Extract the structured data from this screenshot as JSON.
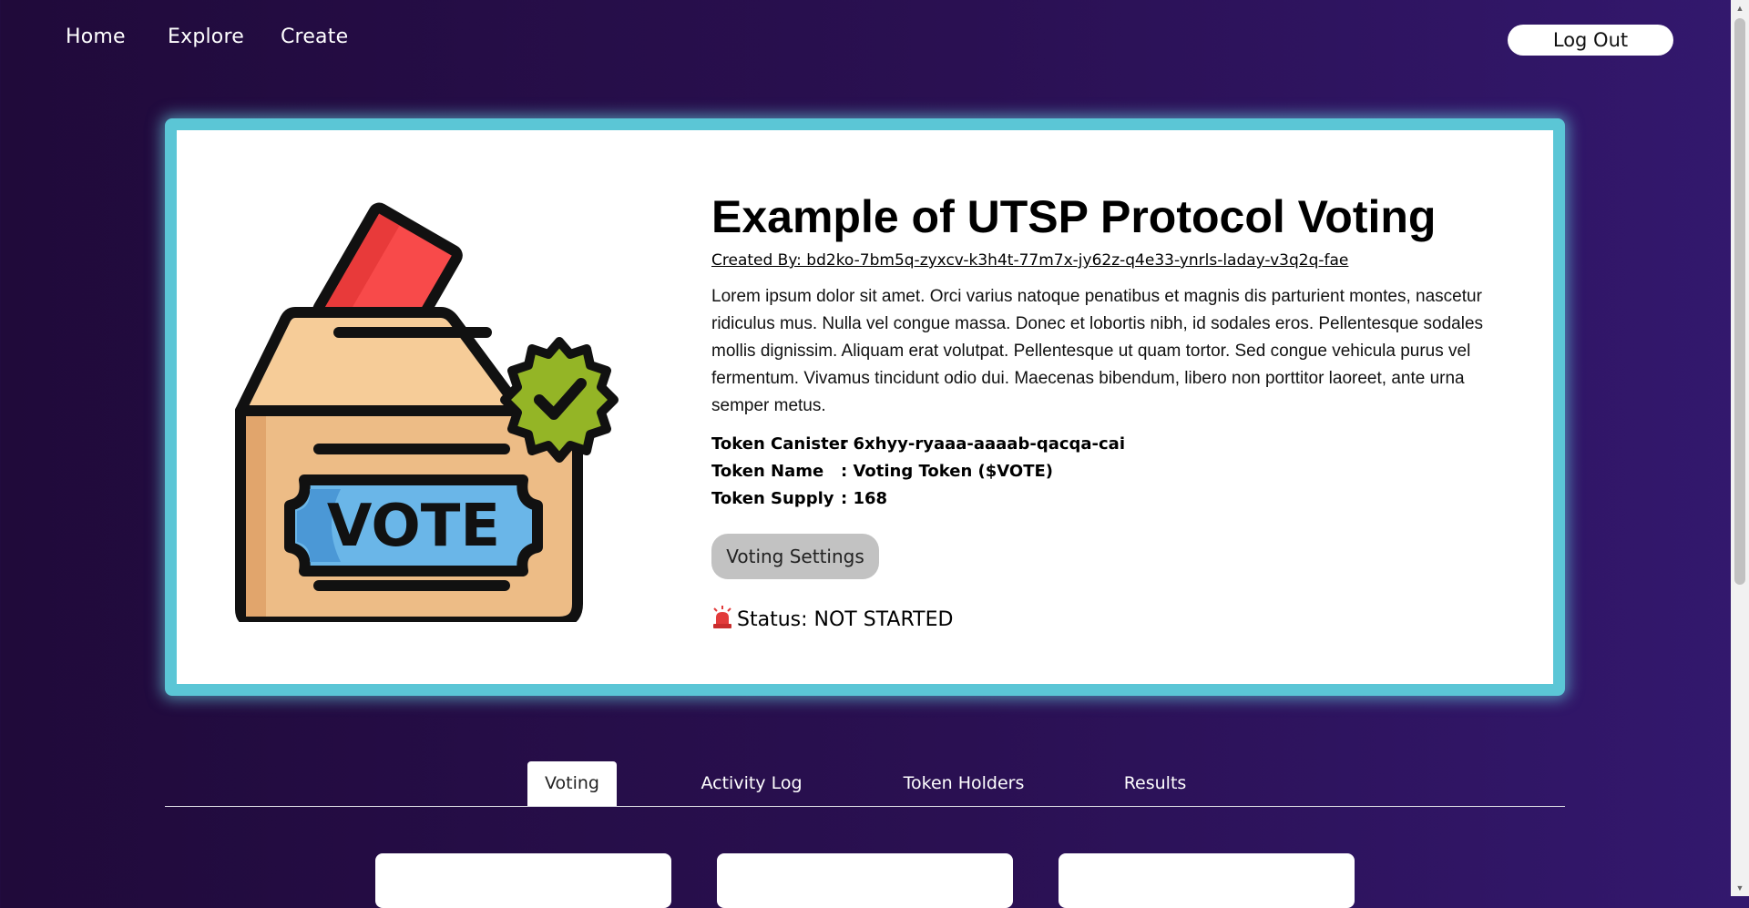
{
  "nav": {
    "home": "Home",
    "explore": "Explore",
    "create": "Create",
    "logout": "Log Out"
  },
  "proposal": {
    "title": "Example of UTSP Protocol Voting",
    "created_by": "Created By: bd2ko-7bm5q-zyxcv-k3h4t-77m7x-jy62z-q4e33-ynrls-laday-v3q2q-fae",
    "description": "Lorem ipsum dolor sit amet. Orci varius natoque penatibus et magnis dis parturient montes, nascetur ridiculus mus. Nulla vel congue massa. Donec et lobortis nibh, id sodales eros. Pellentesque sodales mollis dignissim. Aliquam erat volutpat. Pellentesque ut quam tortor. Sed congue vehicula purus vel fermentum. Vivamus tincidunt odio dui. Maecenas bibendum, libero non porttitor laoreet, ante urna semper metus.",
    "image_text": "VOTE",
    "token": {
      "canister_label": "Token Canister",
      "canister_value": ": 6xhyy-ryaaa-aaaab-qacqa-cai",
      "name_label": "Token Name",
      "name_value": ": Voting Token ($VOTE)",
      "supply_label": "Token Supply",
      "supply_value": ": 168"
    },
    "settings_button": "Voting Settings",
    "status": "Status: NOT STARTED"
  },
  "tabs": [
    "Voting",
    "Activity Log",
    "Token Holders",
    "Results"
  ],
  "colors": {
    "background_start": "#200a3a",
    "background_end": "#33186e",
    "card_border": "#5bc6d6",
    "settings_button": "#c2c2c2",
    "ballot_red": "#f84a4a",
    "box_tan": "#edbc86",
    "vote_blue": "#6ab6e8",
    "badge_green": "#94b526",
    "siren_red": "#e23b3b"
  },
  "icons": [
    "vote-box-illustration",
    "check-badge-icon",
    "siren-icon"
  ]
}
